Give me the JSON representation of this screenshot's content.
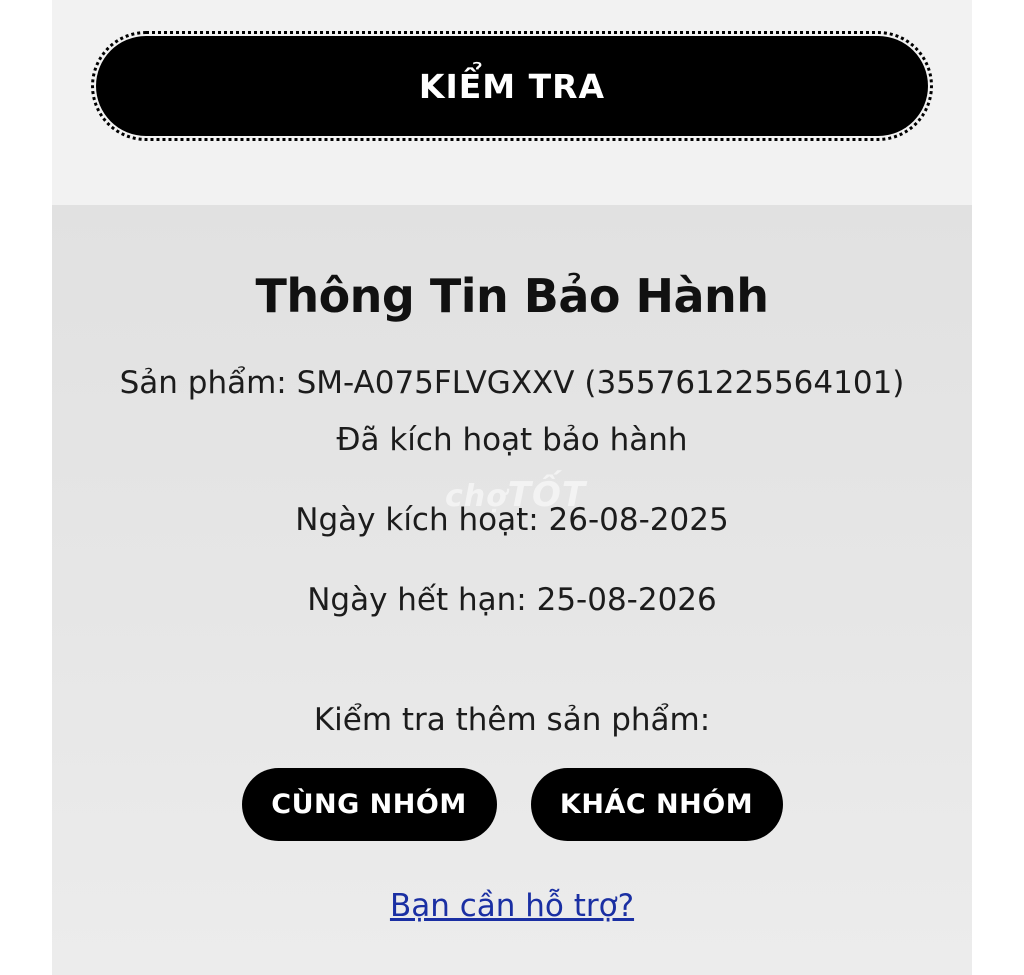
{
  "check_button": {
    "label": "KIỂM TRA"
  },
  "warranty": {
    "title": "Thông Tin Bảo Hành",
    "product_line": "Sản phẩm: SM-A075FLVGXXV (355761225564101)",
    "status": "Đã kích hoạt bảo hành",
    "activation_date": "Ngày kích hoạt: 26-08-2025",
    "expiry_date": "Ngày hết hạn: 25-08-2026",
    "more_label": "Kiểm tra thêm sản phẩm:",
    "same_group_button": "CÙNG NHÓM",
    "other_group_button": "KHÁC NHÓM",
    "help_link": "Bạn cần hỗ trợ?"
  },
  "watermark": {
    "part1": "chợ",
    "part2": "TỐT"
  },
  "colors": {
    "button_bg": "#000000",
    "button_text": "#ffffff",
    "panel_bg": "#e4e4e4",
    "top_bg": "#f2f2f2",
    "link": "#1a2fa3"
  }
}
